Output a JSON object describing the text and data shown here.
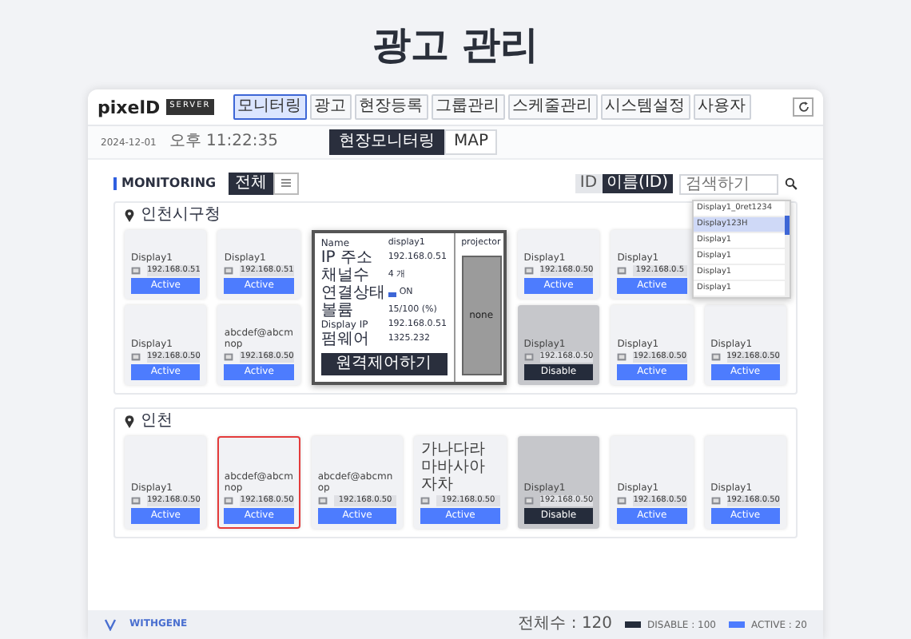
{
  "page_title": "광고 관리",
  "header": {
    "logo": "pixelD",
    "logo_suffix": "SERVER",
    "nav": [
      {
        "label": "모니터링",
        "selected": true
      },
      {
        "label": "광고",
        "selected": false
      },
      {
        "label": "현장등록",
        "selected": false
      },
      {
        "label": "그룹관리",
        "selected": false
      },
      {
        "label": "스케줄관리",
        "selected": false
      },
      {
        "label": "시스템설정",
        "selected": false
      },
      {
        "label": "사용자",
        "selected": false
      }
    ]
  },
  "subheader": {
    "date": "2024-12-01",
    "time": "오후 11:22:35",
    "tabs": [
      {
        "label": "현장모니터링",
        "selected": true
      },
      {
        "label": "MAP",
        "selected": false
      }
    ]
  },
  "monitoring": {
    "title": "MONITORING",
    "view_toggle": [
      {
        "kind": "text",
        "label": "전체",
        "selected": true
      },
      {
        "kind": "icon",
        "selected": false
      }
    ],
    "search": {
      "modes": [
        {
          "label": "ID",
          "selected": false
        },
        {
          "label": "이름(ID)",
          "selected": true
        }
      ],
      "placeholder": "검색하기",
      "suggestions": [
        {
          "label": "Display1_0ret1234",
          "selected": false
        },
        {
          "label": "Display123H",
          "selected": true
        },
        {
          "label": "Display1",
          "selected": false
        },
        {
          "label": "Display1",
          "selected": false
        },
        {
          "label": "Display1",
          "selected": false
        },
        {
          "label": "Display1",
          "selected": false
        }
      ]
    }
  },
  "groups": [
    {
      "name": "인천시구청",
      "rows": [
        [
          {
            "name": "Display1",
            "ip": "192.168.0.51",
            "status": "Active",
            "highlighted": false
          },
          {
            "name": "Display1",
            "ip": "192.168.0.51",
            "status": "Active",
            "highlighted": false
          },
          {
            "name": "Display1",
            "ip": "192.168.0.50",
            "status": "Active",
            "highlighted": false
          },
          {
            "name": "Display1",
            "ip": "192.168.0.5",
            "status": "Active",
            "highlighted": false
          }
        ],
        [
          {
            "name": "Display1",
            "ip": "192.168.0.50",
            "status": "Active",
            "highlighted": false
          },
          {
            "name": "abcdef@abcmnop",
            "ip": "192.168.0.50",
            "status": "Active",
            "highlighted": false
          },
          {
            "name": "Display1",
            "ip": "192.168.0.50",
            "status": "Disable",
            "highlighted": false
          },
          {
            "name": "Display1",
            "ip": "192.168.0.50",
            "status": "Active",
            "highlighted": false
          },
          {
            "name": "Display1",
            "ip": "192.168.0.50",
            "status": "Active",
            "highlighted": false
          }
        ]
      ],
      "popover": {
        "fields": [
          {
            "kind": "text",
            "label": "Name",
            "value": "display1"
          },
          {
            "kind": "text",
            "label": "IP 주소",
            "value": "192.168.0.51"
          },
          {
            "kind": "text",
            "label": "채널수",
            "value": "4 개"
          },
          {
            "kind": "status",
            "label": "연결상태",
            "value": "ON"
          },
          {
            "kind": "text",
            "label": "볼륨",
            "value": "15/100 (%)"
          },
          {
            "kind": "text",
            "label": "Display IP",
            "value": "192.168.0.51"
          },
          {
            "kind": "text",
            "label": "펌웨어",
            "value": "1325.232"
          }
        ],
        "button": "원격제어하기",
        "device": "projector",
        "preview": "none"
      }
    },
    {
      "name": "인천",
      "rows": [
        [
          {
            "name": "Display1",
            "ip": "192.168.0.50",
            "status": "Active",
            "highlighted": false
          },
          {
            "name": "abcdef@abcmnop",
            "ip": "192.168.0.50",
            "status": "Active",
            "highlighted": true
          },
          {
            "name": "abcdef@abcmnop",
            "ip": "192.168.0.50",
            "status": "Active",
            "highlighted": false
          },
          {
            "name": "가나다라마바사아자차",
            "ip": "192.168.0.50",
            "status": "Active",
            "highlighted": false
          },
          {
            "name": "Display1",
            "ip": "192.168.0.50",
            "status": "Disable",
            "highlighted": false
          },
          {
            "name": "Display1",
            "ip": "192.168.0.50",
            "status": "Active",
            "highlighted": false
          },
          {
            "name": "Display1",
            "ip": "192.168.0.50",
            "status": "Active",
            "highlighted": false
          }
        ]
      ]
    }
  ],
  "footer": {
    "brand": "WITHGENE",
    "total": "전체수 : 120",
    "legend": [
      {
        "label": "DISABLE : 100",
        "color": "#252c3b"
      },
      {
        "label": "ACTIVE : 20",
        "color": "#4d7cfe"
      }
    ]
  }
}
